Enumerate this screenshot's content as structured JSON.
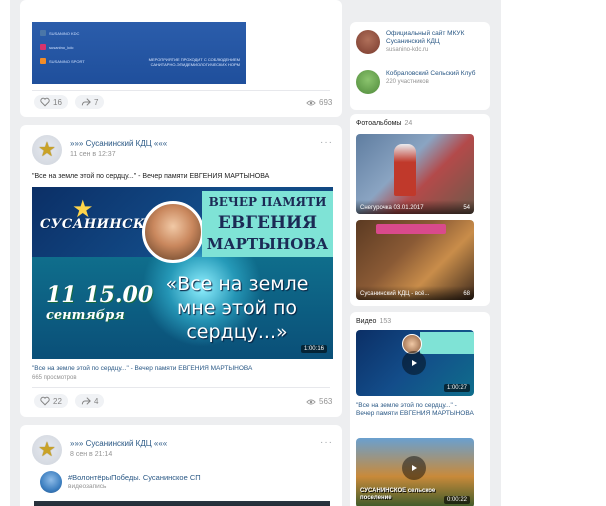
{
  "colors": {
    "page_bg": "#edeef0",
    "link": "#2a5885",
    "muted": "#939393"
  },
  "post1": {
    "banner_social": [
      "SUSANINO KDC",
      "susanino_kdc",
      "SUSANINO SPORT"
    ],
    "banner_note": "МЕРОПРИЯТИЕ ПРОХОДИТ С СОБЛЮДЕНИЕМ САНИТАРНО-ЭПИДЕМИОЛОГИЧЕСКИХ НОРМ",
    "likes": "16",
    "reposts": "7",
    "views": "693"
  },
  "post2": {
    "author": "»»» Сусанинский КДЦ «««",
    "date": "11 сен в 12:37",
    "text": "\"Все на земле этой по сердцу...\" - Вечер памяти ЕВГЕНИЯ МАРТЫНОВА",
    "image": {
      "logo_text": "СУСАНИНСКИЙ",
      "banner_line1": "ВЕЧЕР ПАМЯТИ",
      "banner_line2": "ЕВГЕНИЯ",
      "banner_line3": "МАРТЫНОВА",
      "date_text": "11 15.00",
      "month_text": "сентября",
      "quote": "«Все на земле мне этой по сердцу...»",
      "duration": "1:00:16"
    },
    "video_caption": "\"Все на земле этой по сердцу...\" - Вечер памяти ЕВГЕНИЯ МАРТЫНОВА",
    "video_views": "665 просмотров",
    "likes": "22",
    "reposts": "4",
    "views": "563"
  },
  "post3": {
    "author": "»»» Сусанинский КДЦ «««",
    "date": "8 сен в 21:14",
    "repost_title": "#ВолонтёрыПобеды. Сусанинское СП",
    "repost_sub": "видеозапись"
  },
  "sidebar": {
    "links": [
      {
        "title": "Официальный сайт МКУК Сусанинский КДЦ",
        "sub": "susanino-kdc.ru",
        "color": "#7a3b2e"
      },
      {
        "title": "Кобраловский Сельский Клуб",
        "sub": "220 участников",
        "color": "#4f8a3a"
      }
    ],
    "albums_head": "Фотоальбомы",
    "albums_count": "24",
    "albums": [
      {
        "title": "Снегурочка 03.01.2017",
        "count": "54"
      },
      {
        "title": "Сусанинский КДЦ - всё...",
        "count": "68"
      }
    ],
    "videos_head": "Видео",
    "videos_count": "153",
    "videos": [
      {
        "duration": "1:00:27",
        "caption": "\"Все на земле этой по сердцу...\" - Вечер памяти ЕВГЕНИЯ МАРТЫНОВА"
      },
      {
        "duration": "0:00:22",
        "overlay": "СУСАНИНСКОЕ сельское поселение"
      }
    ]
  }
}
